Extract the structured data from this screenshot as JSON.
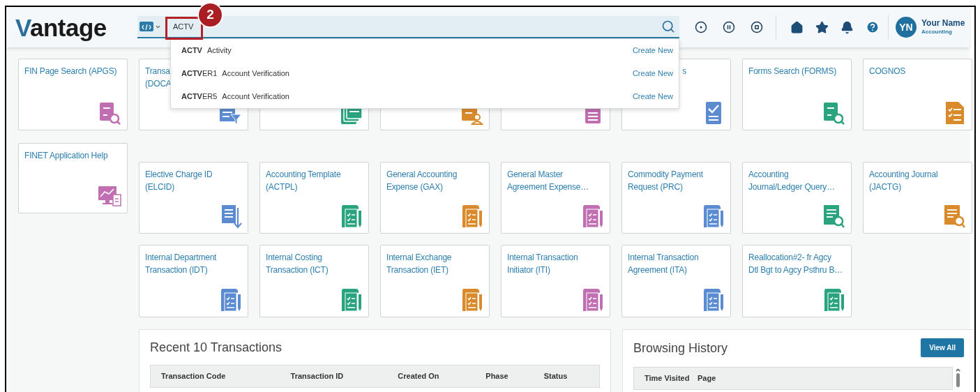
{
  "callout": {
    "number": "2"
  },
  "header": {
    "logo": "Vantage",
    "search": {
      "value": "ACTV"
    },
    "user": {
      "initials": "YN",
      "name": "Your Name",
      "role": "Accounting"
    }
  },
  "suggestions": [
    {
      "code": "**ACTV**",
      "description": "Activity",
      "action": "Create New"
    },
    {
      "code": "**ACTV**ER1",
      "description": "Account Verification",
      "action": "Create New"
    },
    {
      "code": "**ACTV**ER5",
      "description": "Account Verification",
      "action": "Create New"
    }
  ],
  "tiles_row_1": [
    {
      "title": [
        "FIN Page Search (APGS)"
      ],
      "kind": "lookup",
      "color": "#c06fb2"
    },
    {
      "title": [
        "Transa",
        "(DOCA"
      ],
      "kind": "filter",
      "color": "#5b8bd0"
    },
    {
      "kind": "stack",
      "color": "#2aa37f"
    },
    {
      "kind": "person",
      "color": "#d98a2b"
    },
    {
      "kind": "list",
      "color": "#c06fb2"
    },
    {
      "title": [
        "s"
      ],
      "kind": "check",
      "color": "#5b8bd0",
      "covered": true
    },
    {
      "title": [
        "Forms Search (FORMS)"
      ],
      "kind": "lookup",
      "color": "#2aa37f"
    },
    {
      "title": [
        "COGNOS"
      ],
      "kind": "checklist",
      "color": "#d98a2b"
    }
  ],
  "help_tile": {
    "title": [
      "FINET Application Help"
    ],
    "kind": "chart",
    "color": "#c06fb2"
  },
  "tiles_row_2": [
    {
      "title": [
        "Elective Charge ID",
        "(ELCID)"
      ],
      "kind": "download",
      "color": "#5b8bd0"
    },
    {
      "title": [
        "Accounting Template",
        "(ACTPL)"
      ],
      "kind": "scroll",
      "color": "#2aa37f"
    },
    {
      "title": [
        "General Accounting",
        "Expense (GAX)"
      ],
      "kind": "scroll",
      "color": "#d98a2b"
    },
    {
      "title": [
        "General Master",
        "Agreement Expense…"
      ],
      "kind": "scroll",
      "color": "#c06fb2"
    },
    {
      "title": [
        "Commodity Payment",
        "Request (PRC)"
      ],
      "kind": "scroll",
      "color": "#5b8bd0"
    },
    {
      "title": [
        "Accounting",
        "Journal/Ledger Query…"
      ],
      "kind": "listsearch",
      "color": "#2aa37f"
    },
    {
      "title": [
        "Accounting Journal",
        "(JACTG)"
      ],
      "kind": "listsearch",
      "color": "#d98a2b"
    }
  ],
  "tiles_row_3": [
    {
      "title": [
        "Internal Department",
        "Transaction (IDT)"
      ],
      "kind": "scroll",
      "color": "#5b8bd0"
    },
    {
      "title": [
        "Internal Costing",
        "Transaction (ICT)"
      ],
      "kind": "scroll",
      "color": "#2aa37f"
    },
    {
      "title": [
        "Internal Exchange",
        "Transaction (IET)"
      ],
      "kind": "scroll",
      "color": "#d98a2b"
    },
    {
      "title": [
        "Internal Transaction",
        "Initiator (ITI)"
      ],
      "kind": "scroll",
      "color": "#c06fb2"
    },
    {
      "title": [
        "Internal Transaction",
        "Agreement (ITA)"
      ],
      "kind": "scroll",
      "color": "#5b8bd0"
    },
    {
      "title": [
        "Reallocation#2- fr Agcy",
        "Dtl Bgt to Agcy Psthru B…"
      ],
      "kind": "scroll",
      "color": "#2aa37f"
    }
  ],
  "recent_transactions": {
    "title": "Recent 10 Transactions",
    "columns": [
      "Transaction Code",
      "Transaction ID",
      "Created On",
      "Phase",
      "Status"
    ]
  },
  "browsing_history": {
    "title": "Browsing History",
    "button": "View All",
    "columns": [
      "Time Visited",
      "Page"
    ]
  }
}
